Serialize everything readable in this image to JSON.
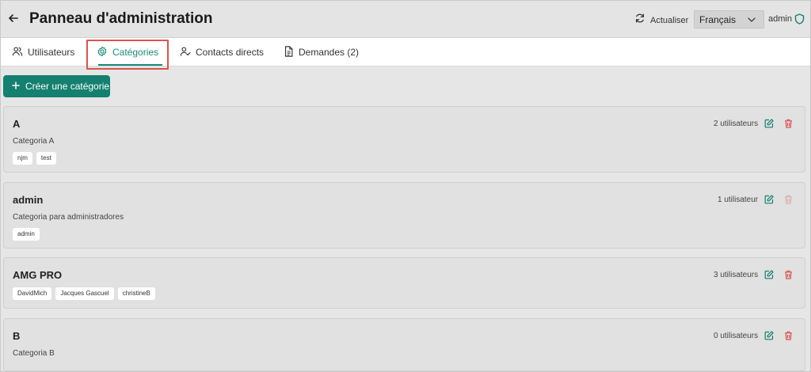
{
  "header": {
    "title": "Panneau d'administration",
    "refresh_label": "Actualiser",
    "language": "Français",
    "user": "admin"
  },
  "tabs": [
    {
      "label": "Utilisateurs",
      "icon": "users-icon",
      "active": false
    },
    {
      "label": "Catégories",
      "icon": "gear-icon",
      "active": true
    },
    {
      "label": "Contacts directs",
      "icon": "user-check-icon",
      "active": false
    },
    {
      "label": "Demandes (2)",
      "icon": "document-icon",
      "active": false
    }
  ],
  "create_button": {
    "label": "Créer une catégorie"
  },
  "categories": [
    {
      "name": "A",
      "description": "Categoria A",
      "users": [
        "njm",
        "test"
      ],
      "count_label": "2 utilisateurs",
      "delete_enabled": true
    },
    {
      "name": "admin",
      "description": "Categoria para administradores",
      "users": [
        "admin"
      ],
      "count_label": "1 utilisateur",
      "delete_enabled": false
    },
    {
      "name": "AMG PRO",
      "description": "",
      "users": [
        "DavidMich",
        "Jacques Gascuel",
        "christineB"
      ],
      "count_label": "3 utilisateurs",
      "delete_enabled": true
    },
    {
      "name": "B",
      "description": "Categoria B",
      "users": [],
      "count_label": "0 utilisateurs",
      "delete_enabled": true
    }
  ],
  "colors": {
    "accent": "#14806f",
    "danger": "#d9534f",
    "highlight": "#d9534f"
  }
}
